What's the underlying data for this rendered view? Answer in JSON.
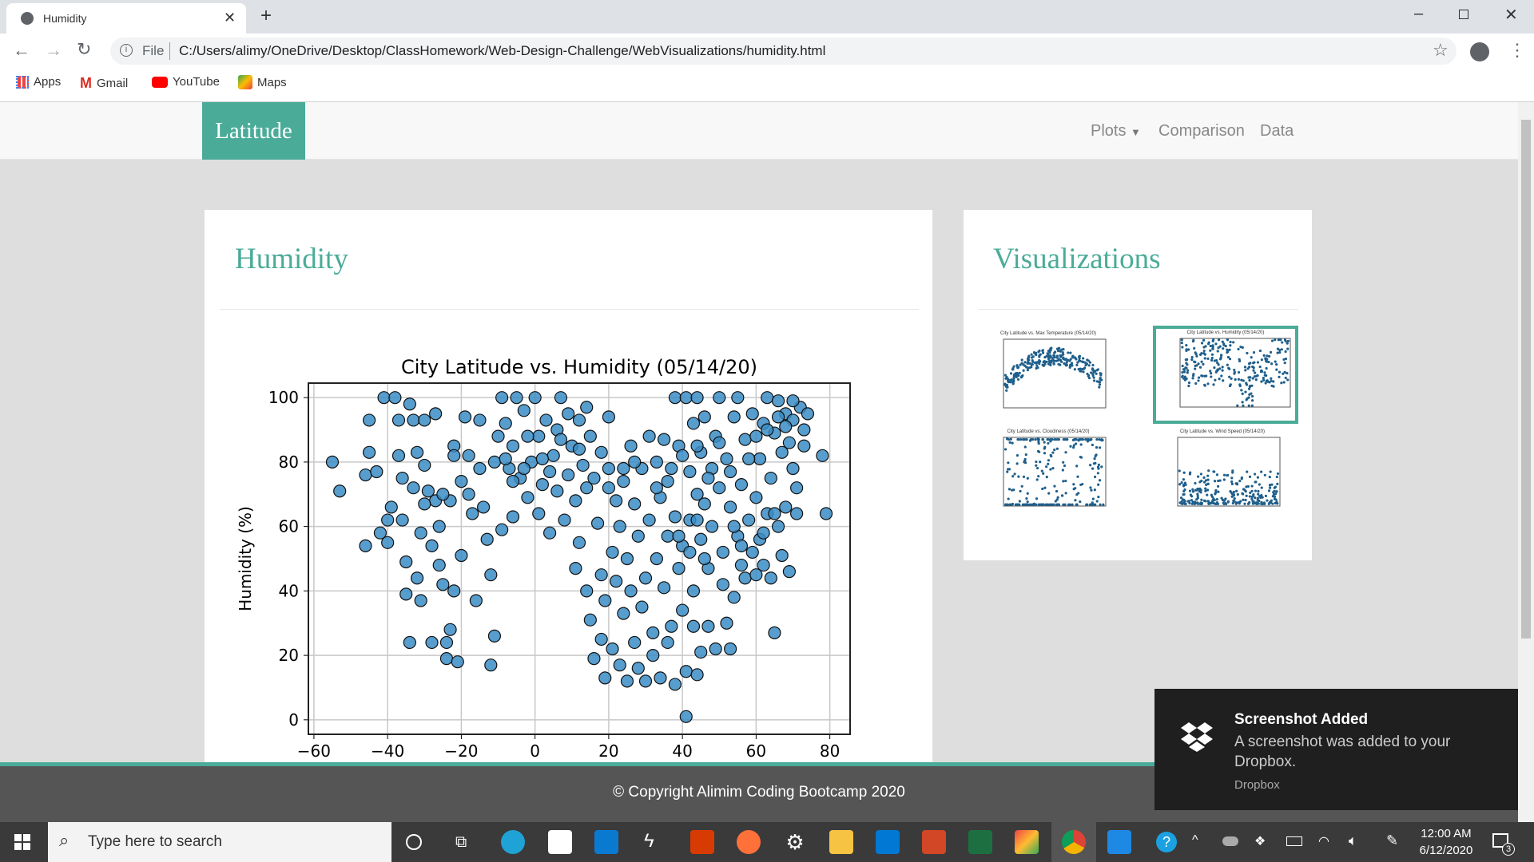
{
  "browser": {
    "tab_title": "Humidity",
    "url_scheme": "File",
    "url": "C:/Users/alimy/OneDrive/Desktop/ClassHomework/Web-Design-Challenge/WebVisualizations/humidity.html",
    "bookmarks": [
      {
        "label": "Apps",
        "icon": "apps-grid-icon"
      },
      {
        "label": "Gmail",
        "icon": "gmail-icon"
      },
      {
        "label": "YouTube",
        "icon": "youtube-icon"
      },
      {
        "label": "Maps",
        "icon": "maps-icon"
      }
    ]
  },
  "navbar": {
    "brand": "Latitude",
    "items": [
      {
        "label": "Plots"
      },
      {
        "label": "Comparison"
      },
      {
        "label": "Data"
      }
    ]
  },
  "main": {
    "title": "Humidity"
  },
  "sidebar": {
    "title": "Visualizations",
    "thumbnails": [
      {
        "title": "City Latitude vs. Max Temperature (05/14/20)",
        "selected": false
      },
      {
        "title": "City Latitude vs. Humidity (05/14/20)",
        "selected": true
      },
      {
        "title": "City Latitude vs. Cloudiness (05/14/20)",
        "selected": false
      },
      {
        "title": "City Latitude vs. Wind Speed (05/14/20)",
        "selected": false
      }
    ]
  },
  "footer": {
    "text": "© Copyright Alimim Coding Bootcamp 2020"
  },
  "toast": {
    "title": "Screenshot Added",
    "body": "A screenshot was added to your Dropbox.",
    "source": "Dropbox"
  },
  "taskbar": {
    "search_placeholder": "Type here to search",
    "time": "12:00 AM",
    "date": "6/12/2020",
    "notification_count": "3"
  },
  "colors": {
    "accent": "#4aab98",
    "marker": "#3a8cc4"
  },
  "chart_data": {
    "type": "scatter",
    "title": "City Latitude vs. Humidity (05/14/20)",
    "xlabel": "",
    "ylabel": "Humidity (%)",
    "xlim": [
      -61.5,
      85.5
    ],
    "ylim": [
      -4.5,
      104.5
    ],
    "grid": true,
    "xticks": [
      -60,
      -40,
      -20,
      0,
      20,
      40,
      60,
      80
    ],
    "yticks": [
      0,
      20,
      40,
      60,
      80,
      100
    ],
    "points": [
      [
        -55,
        80
      ],
      [
        -53,
        71
      ],
      [
        -46,
        54
      ],
      [
        -46,
        76
      ],
      [
        -45,
        83
      ],
      [
        -45,
        93
      ],
      [
        -43,
        77
      ],
      [
        -42,
        58
      ],
      [
        -41,
        100
      ],
      [
        -40,
        62
      ],
      [
        -40,
        55
      ],
      [
        -39,
        66
      ],
      [
        -38,
        100
      ],
      [
        -37,
        93
      ],
      [
        -37,
        82
      ],
      [
        -36,
        75
      ],
      [
        -36,
        62
      ],
      [
        -35,
        49
      ],
      [
        -35,
        39
      ],
      [
        -34,
        24
      ],
      [
        -34,
        98
      ],
      [
        -33,
        93
      ],
      [
        -33,
        72
      ],
      [
        -32,
        83
      ],
      [
        -32,
        44
      ],
      [
        -31,
        58
      ],
      [
        -31,
        37
      ],
      [
        -30,
        93
      ],
      [
        -30,
        79
      ],
      [
        -29,
        71
      ],
      [
        -28,
        54
      ],
      [
        -28,
        24
      ],
      [
        -27,
        95
      ],
      [
        -27,
        68
      ],
      [
        -26,
        60
      ],
      [
        -26,
        48
      ],
      [
        -25,
        42
      ],
      [
        -24,
        24
      ],
      [
        -24,
        19
      ],
      [
        -23,
        28
      ],
      [
        -23,
        68
      ],
      [
        -22,
        85
      ],
      [
        -22,
        40
      ],
      [
        -21,
        18
      ],
      [
        -20,
        51
      ],
      [
        -20,
        74
      ],
      [
        -19,
        94
      ],
      [
        -18,
        82
      ],
      [
        -17,
        64
      ],
      [
        -16,
        37
      ],
      [
        -15,
        93
      ],
      [
        -14,
        66
      ],
      [
        -13,
        56
      ],
      [
        -12,
        45
      ],
      [
        -12,
        17
      ],
      [
        -11,
        26
      ],
      [
        -11,
        80
      ],
      [
        -10,
        88
      ],
      [
        -9,
        100
      ],
      [
        -9,
        59
      ],
      [
        -8,
        92
      ],
      [
        -7,
        78
      ],
      [
        -6,
        63
      ],
      [
        -6,
        85
      ],
      [
        -5,
        100
      ],
      [
        -4,
        75
      ],
      [
        -3,
        96
      ],
      [
        -2,
        69
      ],
      [
        -1,
        80
      ],
      [
        0,
        100
      ],
      [
        1,
        88
      ],
      [
        1,
        64
      ],
      [
        2,
        73
      ],
      [
        3,
        93
      ],
      [
        4,
        58
      ],
      [
        5,
        82
      ],
      [
        6,
        90
      ],
      [
        6,
        71
      ],
      [
        7,
        100
      ],
      [
        8,
        62
      ],
      [
        9,
        76
      ],
      [
        10,
        85
      ],
      [
        11,
        68
      ],
      [
        11,
        47
      ],
      [
        12,
        55
      ],
      [
        12,
        93
      ],
      [
        13,
        79
      ],
      [
        14,
        40
      ],
      [
        14,
        72
      ],
      [
        15,
        88
      ],
      [
        15,
        31
      ],
      [
        16,
        19
      ],
      [
        17,
        61
      ],
      [
        18,
        83
      ],
      [
        18,
        45
      ],
      [
        18,
        25
      ],
      [
        19,
        13
      ],
      [
        19,
        37
      ],
      [
        20,
        94
      ],
      [
        20,
        78
      ],
      [
        21,
        52
      ],
      [
        21,
        22
      ],
      [
        22,
        68
      ],
      [
        22,
        43
      ],
      [
        23,
        17
      ],
      [
        23,
        60
      ],
      [
        24,
        78
      ],
      [
        24,
        33
      ],
      [
        25,
        50
      ],
      [
        25,
        12
      ],
      [
        26,
        85
      ],
      [
        26,
        40
      ],
      [
        27,
        67
      ],
      [
        27,
        24
      ],
      [
        28,
        57
      ],
      [
        28,
        16
      ],
      [
        29,
        78
      ],
      [
        29,
        35
      ],
      [
        30,
        44
      ],
      [
        30,
        12
      ],
      [
        31,
        88
      ],
      [
        31,
        62
      ],
      [
        32,
        27
      ],
      [
        32,
        20
      ],
      [
        33,
        80
      ],
      [
        33,
        50
      ],
      [
        34,
        69
      ],
      [
        34,
        13
      ],
      [
        35,
        87
      ],
      [
        35,
        41
      ],
      [
        36,
        24
      ],
      [
        36,
        57
      ],
      [
        37,
        78
      ],
      [
        37,
        29
      ],
      [
        38,
        100
      ],
      [
        38,
        63
      ],
      [
        38,
        11
      ],
      [
        39,
        85
      ],
      [
        39,
        47
      ],
      [
        40,
        34
      ],
      [
        40,
        54
      ],
      [
        41,
        100
      ],
      [
        41,
        1
      ],
      [
        41,
        15
      ],
      [
        42,
        77
      ],
      [
        42,
        62
      ],
      [
        43,
        92
      ],
      [
        43,
        40
      ],
      [
        43,
        29
      ],
      [
        44,
        100
      ],
      [
        44,
        70
      ],
      [
        44,
        14
      ],
      [
        45,
        83
      ],
      [
        45,
        56
      ],
      [
        45,
        21
      ],
      [
        46,
        67
      ],
      [
        46,
        94
      ],
      [
        47,
        47
      ],
      [
        47,
        29
      ],
      [
        48,
        78
      ],
      [
        48,
        60
      ],
      [
        49,
        22
      ],
      [
        49,
        88
      ],
      [
        50,
        100
      ],
      [
        50,
        72
      ],
      [
        51,
        52
      ],
      [
        51,
        42
      ],
      [
        52,
        30
      ],
      [
        52,
        81
      ],
      [
        53,
        66
      ],
      [
        53,
        22
      ],
      [
        54,
        94
      ],
      [
        54,
        38
      ],
      [
        55,
        100
      ],
      [
        55,
        57
      ],
      [
        56,
        73
      ],
      [
        56,
        48
      ],
      [
        57,
        87
      ],
      [
        57,
        44
      ],
      [
        58,
        62
      ],
      [
        59,
        95
      ],
      [
        59,
        52
      ],
      [
        60,
        69
      ],
      [
        60,
        45
      ],
      [
        61,
        81
      ],
      [
        61,
        56
      ],
      [
        62,
        92
      ],
      [
        62,
        48
      ],
      [
        63,
        64
      ],
      [
        63,
        100
      ],
      [
        64,
        75
      ],
      [
        64,
        44
      ],
      [
        65,
        89
      ],
      [
        65,
        27
      ],
      [
        66,
        99
      ],
      [
        66,
        60
      ],
      [
        67,
        83
      ],
      [
        67,
        51
      ],
      [
        68,
        95
      ],
      [
        68,
        66
      ],
      [
        69,
        86
      ],
      [
        69,
        46
      ],
      [
        70,
        93
      ],
      [
        70,
        78
      ],
      [
        71,
        64
      ],
      [
        71,
        72
      ],
      [
        72,
        97
      ],
      [
        73,
        90
      ],
      [
        73,
        85
      ],
      [
        74,
        95
      ],
      [
        78,
        82
      ],
      [
        79,
        64
      ],
      [
        -8,
        81
      ],
      [
        -6,
        74
      ],
      [
        -3,
        78
      ],
      [
        -2,
        88
      ],
      [
        2,
        81
      ],
      [
        4,
        77
      ],
      [
        7,
        87
      ],
      [
        9,
        95
      ],
      [
        12,
        84
      ],
      [
        14,
        97
      ],
      [
        16,
        75
      ],
      [
        20,
        72
      ],
      [
        24,
        74
      ],
      [
        27,
        80
      ],
      [
        33,
        72
      ],
      [
        36,
        74
      ],
      [
        40,
        82
      ],
      [
        44,
        85
      ],
      [
        47,
        75
      ],
      [
        50,
        86
      ],
      [
        53,
        77
      ],
      [
        58,
        81
      ],
      [
        60,
        88
      ],
      [
        63,
        90
      ],
      [
        66,
        94
      ],
      [
        68,
        91
      ],
      [
        70,
        99
      ],
      [
        54,
        60
      ],
      [
        56,
        54
      ],
      [
        62,
        58
      ],
      [
        65,
        64
      ],
      [
        44,
        62
      ],
      [
        42,
        52
      ],
      [
        46,
        50
      ],
      [
        39,
        57
      ],
      [
        -30,
        67
      ],
      [
        -25,
        70
      ],
      [
        -18,
        70
      ],
      [
        -15,
        78
      ],
      [
        -22,
        82
      ]
    ]
  }
}
